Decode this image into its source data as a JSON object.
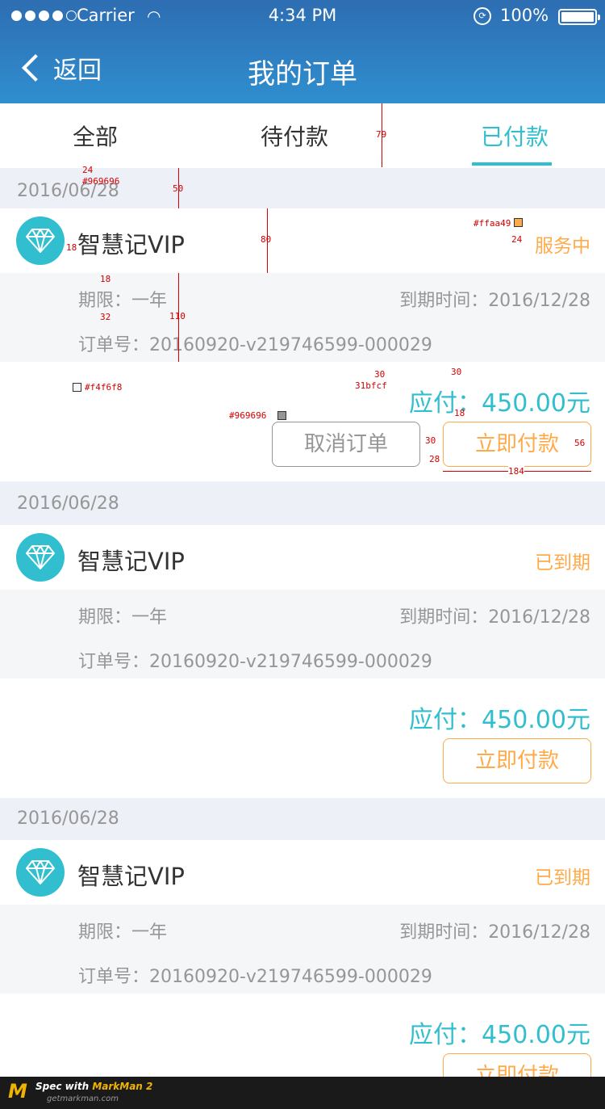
{
  "status_bar": {
    "carrier": "Carrier",
    "time": "4:34 PM",
    "battery": "100%"
  },
  "nav": {
    "back_label": "返回",
    "title": "我的订单"
  },
  "tabs": [
    {
      "label": "全部",
      "active": false
    },
    {
      "label": "待付款",
      "active": false
    },
    {
      "label": "已付款",
      "active": true
    }
  ],
  "colors": {
    "accent": "#31bfcf",
    "warning": "#ffaa49",
    "muted": "#969696",
    "grey_bg": "#f4f6f8",
    "header": "#2e6db2"
  },
  "orders": [
    {
      "date": "2016/06/28",
      "product": "智慧记VIP",
      "status": "服务中",
      "term": "期限：一年",
      "expiry": "到期时间：2016/12/28",
      "order_no": "订单号：20160920-v219746599-000029",
      "amount": "应付：450.00元",
      "cancel_label": "取消订单",
      "pay_label": "立即付款"
    },
    {
      "date": "2016/06/28",
      "product": "智慧记VIP",
      "status": "已到期",
      "term": "期限：一年",
      "expiry": "到期时间：2016/12/28",
      "order_no": "订单号：20160920-v219746599-000029",
      "amount": "应付：450.00元",
      "pay_label": "立即付款"
    },
    {
      "date": "2016/06/28",
      "product": "智慧记VIP",
      "status": "已到期",
      "term": "期限：一年",
      "expiry": "到期时间：2016/12/28",
      "order_no": "订单号：20160920-v219746599-000029",
      "amount": "应付：450.00元",
      "pay_label": "立即付款"
    }
  ],
  "spec_annotations": {
    "tab_height": "79",
    "date_height": "50",
    "row_height": "80",
    "info_height": "110",
    "logo_gap": "18",
    "info_pad_top": "18",
    "info_line_gap": "32",
    "date_font": "24",
    "date_color": "#969696",
    "status_color": "#ffaa49",
    "status_font": "24",
    "grey_color": "#f4f6f8",
    "price_font": "30",
    "price_color": "31bfcf",
    "price_top": "30",
    "price_gap": "18",
    "btn_color": "#969696",
    "btn_gap": "30",
    "btn_font": "28",
    "btn_height": "56",
    "btn_width": "184"
  },
  "footer": {
    "brand_prefix": "Spec with",
    "brand": "MarkMan 2",
    "url": "getmarkman.com"
  }
}
